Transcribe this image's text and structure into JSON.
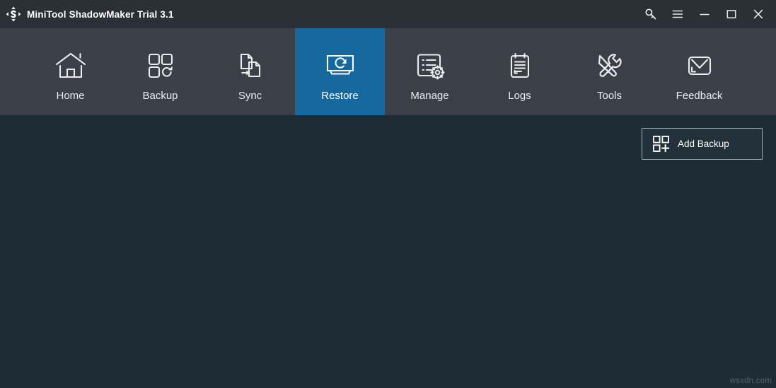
{
  "window": {
    "title": "MiniTool ShadowMaker Trial 3.1",
    "logo_icon": "move-arrows-logo-icon",
    "controls": [
      {
        "name": "key-icon",
        "label": "Register"
      },
      {
        "name": "hamburger-menu-icon",
        "label": "Menu"
      },
      {
        "name": "minimize-icon",
        "label": "Minimize"
      },
      {
        "name": "maximize-icon",
        "label": "Maximize"
      },
      {
        "name": "close-icon",
        "label": "Close"
      }
    ]
  },
  "nav": {
    "active": "Restore",
    "items": [
      {
        "label": "Home",
        "icon": "house-icon"
      },
      {
        "label": "Backup",
        "icon": "four-squares-refresh-icon"
      },
      {
        "label": "Sync",
        "icon": "two-pages-arrow-icon"
      },
      {
        "label": "Restore",
        "icon": "monitor-refresh-icon"
      },
      {
        "label": "Manage",
        "icon": "list-gear-icon"
      },
      {
        "label": "Logs",
        "icon": "clipboard-lines-icon"
      },
      {
        "label": "Tools",
        "icon": "screwdriver-wrench-icon"
      },
      {
        "label": "Feedback",
        "icon": "envelope-icon"
      }
    ]
  },
  "content": {
    "add_backup": {
      "label": "Add Backup",
      "icon": "four-squares-plus-icon"
    },
    "watermark": "wsxdn.com"
  },
  "colors": {
    "titlebar_bg": "#2b3036",
    "navbar_bg": "#3b4048",
    "active_tab_bg": "#15699f",
    "content_bg": "#1e2d33",
    "text": "#e9eced",
    "button_border": "#a7b0b5"
  }
}
